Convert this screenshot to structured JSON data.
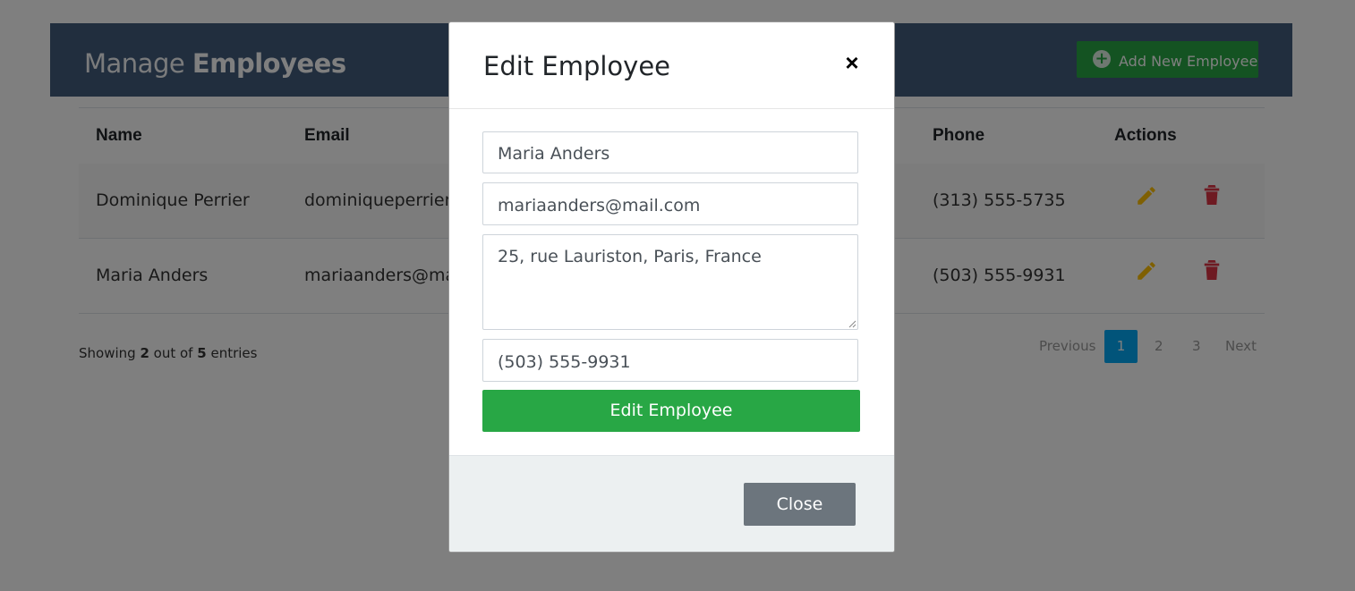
{
  "header": {
    "title_light": "Manage",
    "title_bold": "Employees",
    "add_button": "Add New Employee"
  },
  "table": {
    "columns": {
      "name": "Name",
      "email": "Email",
      "phone": "Phone",
      "actions": "Actions"
    },
    "rows": [
      {
        "name": "Dominique Perrier",
        "email": "dominiqueperrier@",
        "phone": "(313) 555-5735"
      },
      {
        "name": "Maria Anders",
        "email": "mariaanders@mai",
        "phone": "(503) 555-9931"
      }
    ]
  },
  "footer": {
    "showing": "Showing",
    "shown": "2",
    "out_of": "out of",
    "total": "5",
    "entries": "entries"
  },
  "pagination": {
    "previous": "Previous",
    "pages": [
      "1",
      "2",
      "3"
    ],
    "next": "Next",
    "active": "1"
  },
  "modal": {
    "title": "Edit Employee",
    "close_symbol": "×",
    "name_value": "Maria Anders",
    "email_value": "mariaanders@mail.com",
    "address_value": "25, rue Lauriston, Paris, France",
    "phone_value": "(503) 555-9931",
    "submit_label": "Edit Employee",
    "close_label": "Close"
  },
  "colors": {
    "header": "#435d7d",
    "success": "#28a745",
    "edit_icon": "#ffc107",
    "delete_icon": "#dc3545",
    "page_active": "#03a9f4"
  }
}
